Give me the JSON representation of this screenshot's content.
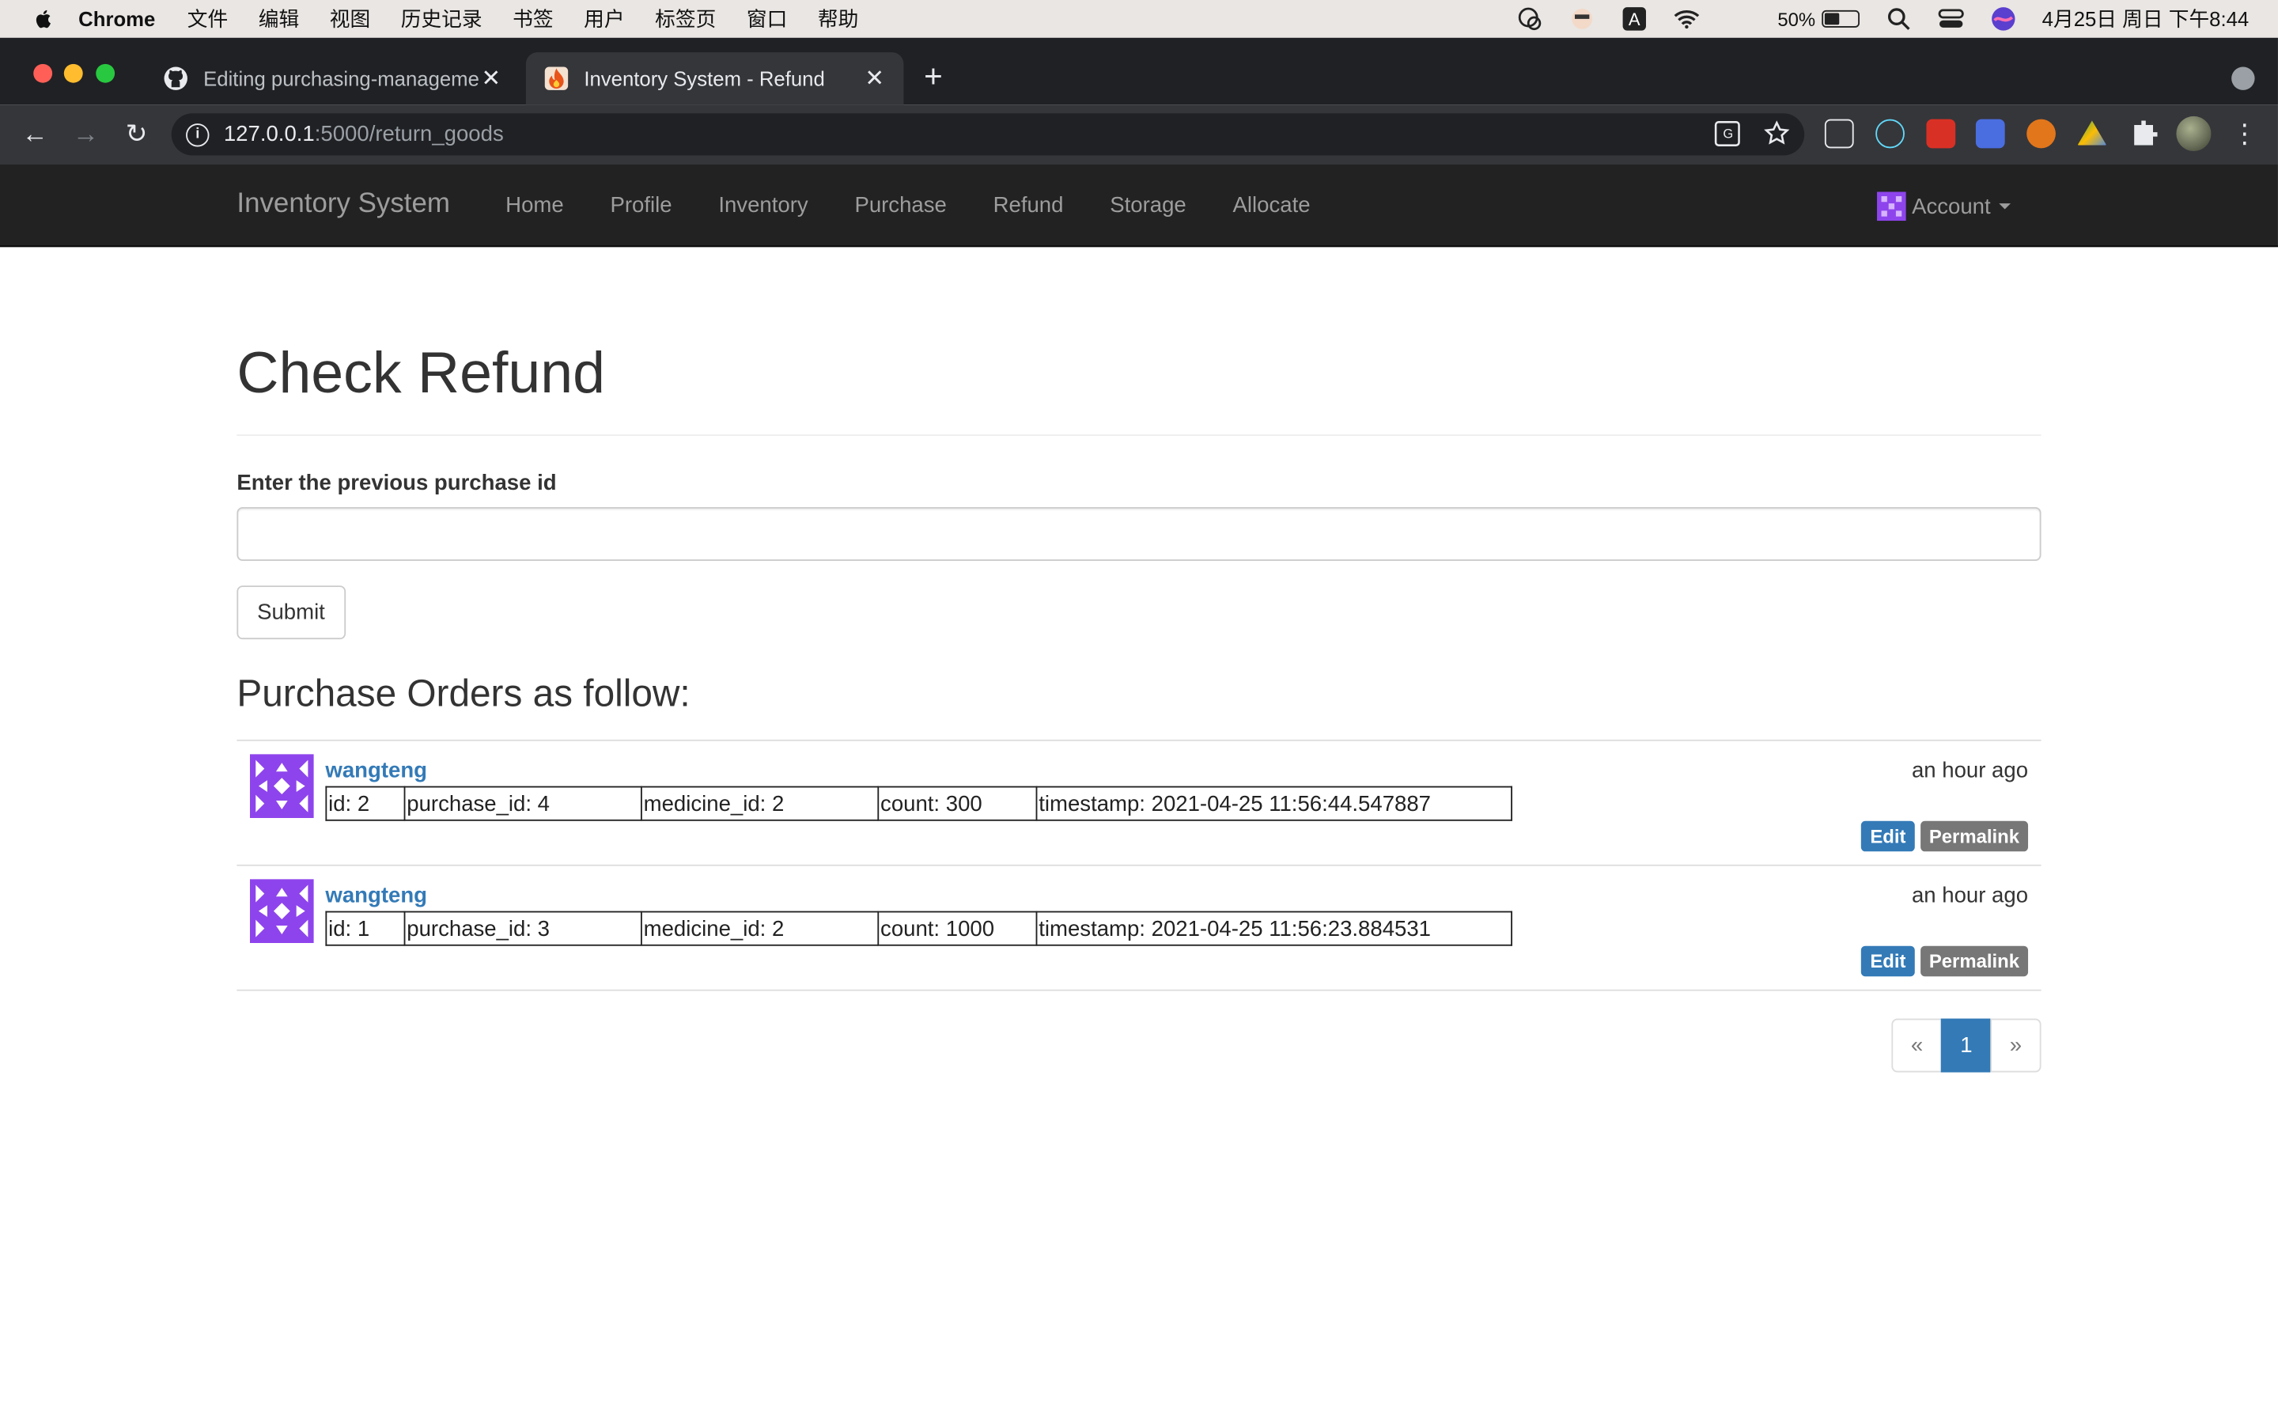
{
  "menubar": {
    "app": "Chrome",
    "items": [
      "文件",
      "编辑",
      "视图",
      "历史记录",
      "书签",
      "用户",
      "标签页",
      "窗口",
      "帮助"
    ],
    "battery_percent": "50%",
    "battery_level": 0.5,
    "clock": "4月25日 周日 下午8:44"
  },
  "browser": {
    "tabs": [
      {
        "title": "Editing purchasing-manageme",
        "icon": "github-icon",
        "active": false
      },
      {
        "title": "Inventory System - Refund",
        "icon": "flame-icon",
        "active": true
      }
    ],
    "url_host": "127.0.0.1",
    "url_path": ":5000/return_goods"
  },
  "navbar": {
    "brand": "Inventory System",
    "links": [
      "Home",
      "Profile",
      "Inventory",
      "Purchase",
      "Refund",
      "Storage",
      "Allocate"
    ],
    "account": "Account"
  },
  "page": {
    "title": "Check Refund",
    "form_label": "Enter the previous purchase id",
    "input_value": "",
    "submit_label": "Submit",
    "list_title": "Purchase Orders as follow:"
  },
  "orders": [
    {
      "author": "wangteng",
      "date": "an hour ago",
      "cells": [
        "id: 2",
        "purchase_id: 4",
        "medicine_id: 2",
        "count: 300",
        "timestamp: 2021-04-25 11:56:44.547887"
      ],
      "edit": "Edit",
      "permalink": "Permalink"
    },
    {
      "author": "wangteng",
      "date": "an hour ago",
      "cells": [
        "id: 1",
        "purchase_id: 3",
        "medicine_id: 2",
        "count: 1000",
        "timestamp: 2021-04-25 11:56:23.884531"
      ],
      "edit": "Edit",
      "permalink": "Permalink"
    }
  ],
  "pagination": {
    "prev": "«",
    "current": "1",
    "next": "»"
  },
  "colors": {
    "navbar_bg": "#222222",
    "link": "#337ab7",
    "avatar": "#8e44ec"
  }
}
